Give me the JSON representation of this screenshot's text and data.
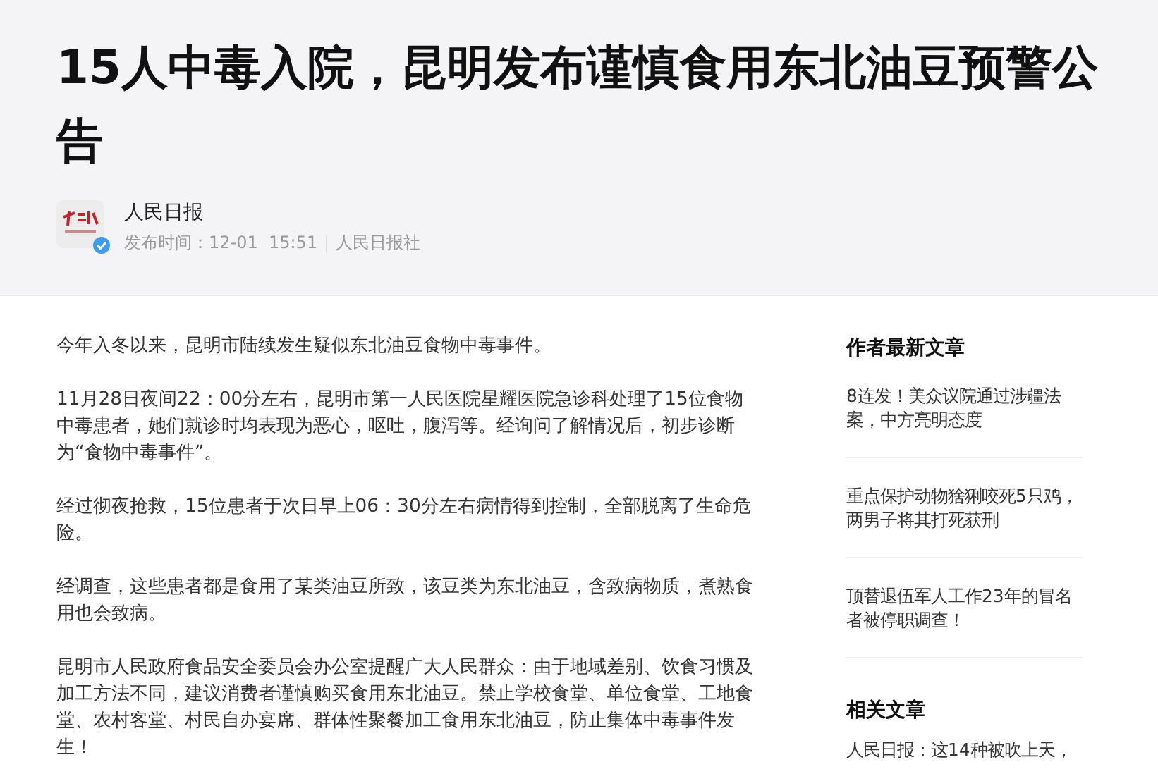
{
  "article": {
    "title": "15人中毒入院，昆明发布谨慎食用东北油豆预警公告",
    "author": {
      "name": "人民日报",
      "verified": true,
      "time_label": "发布时间：",
      "date": "12-01",
      "time": "15:51",
      "source": "人民日报社"
    },
    "paragraphs": [
      "今年入冬以来，昆明市陆续发生疑似东北油豆食物中毒事件。",
      "11月28日夜间22：00分左右，昆明市第一人民医院星耀医院急诊科处理了15位食物中毒患者，她们就诊时均表现为恶心，呕吐，腹泻等。经询问了解情况后，初步诊断为“食物中毒事件”。",
      "经过彻夜抢救，15位患者于次日早上06：30分左右病情得到控制，全部脱离了生命危险。",
      "经调查，这些患者都是食用了某类油豆所致，该豆类为东北油豆，含致病物质，煮熟食用也会致病。",
      "昆明市人民政府食品安全委员会办公室提醒广大人民群众：由于地域差别、饮食习惯及加工方法不同，建议消费者谨慎购买食用东北油豆。禁止学校食堂、单位食堂、工地食堂、农村客堂、村民自办宴席、群体性聚餐加工食用东北油豆，防止集体中毒事件发生！"
    ]
  },
  "sidebar": {
    "sections": [
      {
        "heading": "作者最新文章",
        "items": [
          "8连发！美众议院通过涉疆法案，中方亮明态度",
          "重点保护动物猞猁咬死5只鸡，两男子将其打死获刑",
          "顶替退伍军人工作23年的冒名者被停职调查！"
        ]
      },
      {
        "heading": "相关文章",
        "items": [
          "人民日报：这14种被吹上天，"
        ]
      }
    ]
  }
}
